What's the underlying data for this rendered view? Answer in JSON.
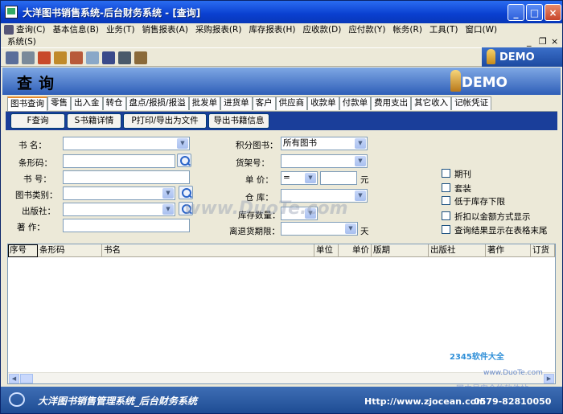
{
  "window": {
    "title": "大洋图书销售系统-后台财务系统 - [查询]",
    "minimize": "_",
    "maximize": "□",
    "close": "×"
  },
  "menu": {
    "items": [
      "查询(C)",
      "基本信息(B)",
      "业务(T)",
      "销售报表(A)",
      "采购报表(R)",
      "库存报表(H)",
      "应收款(D)",
      "应付款(Y)",
      "帐务(R)",
      "工具(T)",
      "窗口(W)"
    ],
    "second_row": "系统(S)",
    "mdi_min": "_",
    "mdi_restore": "❐",
    "mdi_close": "×"
  },
  "demo_label": "DEMO",
  "header": {
    "title": "查询",
    "demo": "DEMO"
  },
  "tabs": [
    "图书查询",
    "零售",
    "出入金",
    "转仓",
    "盘点/报损/报溢",
    "批发单",
    "进货单",
    "客户",
    "供应商",
    "收款单",
    "付款单",
    "费用支出",
    "其它收入",
    "记帐凭证"
  ],
  "actions": {
    "query": "F查询",
    "detail": "S书籍详情",
    "print": "P打印/导出为文件",
    "export": "导出书籍信息"
  },
  "form": {
    "book_name_label": "书  名：",
    "barcode_label": "条形码：",
    "book_no_label": "书  号：",
    "category_label": "图书类别：",
    "publisher_label": "出版社：",
    "author_label": "著  作：",
    "points_label": "积分图书：",
    "points_value": "所有图书",
    "shelf_label": "货架号：",
    "price_label": "单  价：",
    "price_op": "=",
    "price_unit": "元",
    "warehouse_label": "仓  库：",
    "stock_label": "库存数量：",
    "overdue_label": "离退货期限：",
    "overdue_unit": "天",
    "checkboxes": [
      "期刊",
      "套装",
      "低于库存下限",
      "折扣以金额方式显示",
      "查询结果显示在表格末尾"
    ]
  },
  "grid": {
    "columns": [
      "序号",
      "条形码",
      "书名",
      "单位",
      "单价",
      "版期",
      "出版社",
      "著作",
      "订货"
    ]
  },
  "footer": {
    "title": "大洋图书销售管理系统_后台财务系统",
    "url": "Http://www.zjocean.com",
    "phone": "0579-82810050"
  },
  "watermarks": {
    "brand": "2345软件大全",
    "site": "www.DuoTe.com",
    "slogan": "国内最安全的软件站",
    "center": "www.DuoTe.com"
  }
}
